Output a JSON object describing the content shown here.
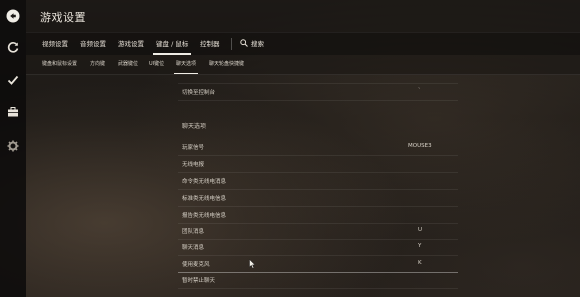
{
  "window": {
    "title": "游戏设置"
  },
  "sidebar": {
    "items": [
      {
        "icon": "back-icon"
      },
      {
        "icon": "refresh-icon"
      },
      {
        "icon": "check-icon"
      },
      {
        "icon": "briefcase-icon"
      },
      {
        "icon": "gear-icon"
      }
    ]
  },
  "tabs": [
    {
      "label": "视频设置"
    },
    {
      "label": "音频设置"
    },
    {
      "label": "游戏设置"
    },
    {
      "label": "键盘 / 鼠标"
    },
    {
      "label": "控制器"
    }
  ],
  "search": {
    "label": "搜索"
  },
  "subtabs": [
    {
      "label": "键盘和鼠标设置"
    },
    {
      "label": "方向键"
    },
    {
      "label": "武器键位"
    },
    {
      "label": "UI键位"
    },
    {
      "label": "聊天选项"
    },
    {
      "label": "聊天轮盘快捷键"
    }
  ],
  "rows_top": [
    {
      "label": "切换至控制台",
      "value": "`"
    }
  ],
  "section": {
    "title": "聊天选项"
  },
  "rows": [
    {
      "label": "玩家信号",
      "value": "MOUSE3"
    },
    {
      "label": "无线电报",
      "value": ""
    },
    {
      "label": "命令类无线电消息",
      "value": ""
    },
    {
      "label": "标准类无线电信息",
      "value": ""
    },
    {
      "label": "报告类无线电信息",
      "value": ""
    },
    {
      "label": "团队消息",
      "value": "U"
    },
    {
      "label": "聊天消息",
      "value": "Y"
    },
    {
      "label": "使用麦克风",
      "value": "K"
    },
    {
      "label": "暂时禁止聊天",
      "value": ""
    }
  ],
  "colors": {
    "accent": "#f0ede6",
    "sidebar": "#0c0b0a"
  }
}
